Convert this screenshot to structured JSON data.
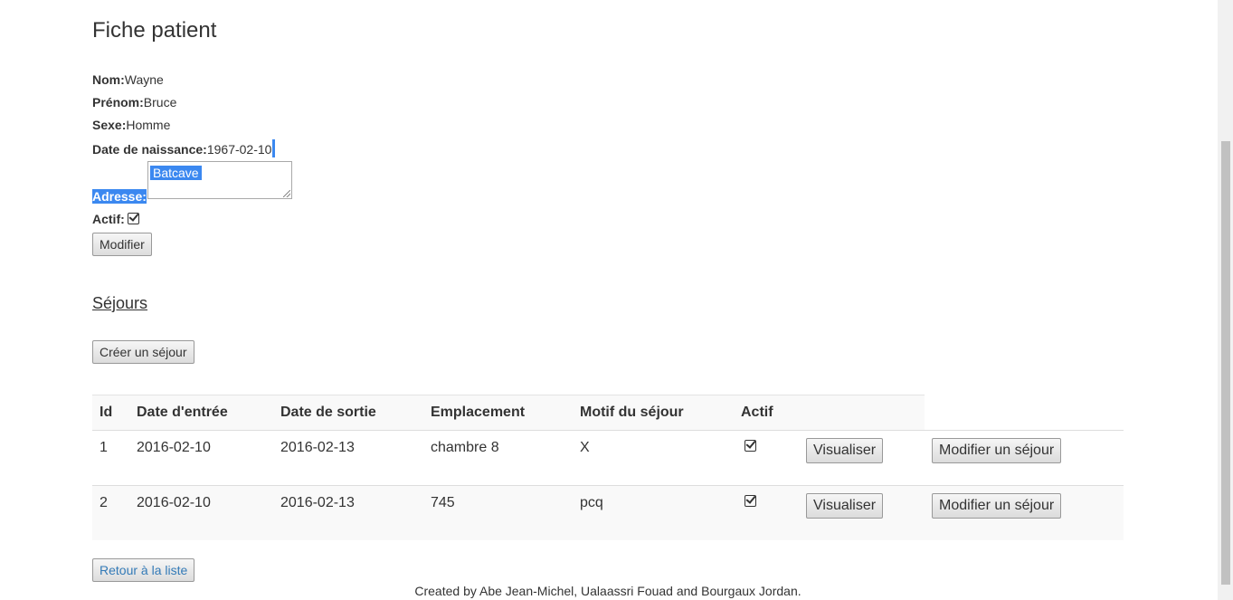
{
  "patient": {
    "title": "Fiche patient",
    "nom_label": "Nom:",
    "nom": "Wayne",
    "prenom_label": "Prénom:",
    "prenom": "Bruce",
    "sexe_label": "Sexe:",
    "sexe": "Homme",
    "naissance_label": "Date de naissance:",
    "naissance": "1967-02-10",
    "adresse_label": "Adresse:",
    "adresse": "Batcave",
    "actif_label": "Actif:",
    "modifier_label": "Modifier"
  },
  "sejours": {
    "title": "Séjours",
    "creer_label": "Créer un séjour",
    "headers": [
      "Id",
      "Date d'entrée",
      "Date de sortie",
      "Emplacement",
      "Motif du séjour",
      "Actif"
    ],
    "rows": [
      {
        "id": "1",
        "entree": "2016-02-10",
        "sortie": "2016-02-13",
        "emplacement": "chambre 8",
        "motif": "X",
        "actif": true
      },
      {
        "id": "2",
        "entree": "2016-02-10",
        "sortie": "2016-02-13",
        "emplacement": "745",
        "motif": "pcq",
        "actif": true
      }
    ],
    "visualiser_label": "Visualiser",
    "modifier_sejour_label": "Modifier un séjour"
  },
  "retour_label": "Retour à la liste",
  "footer": "Created by Abe Jean-Michel, Ualaassri Fouad and Bourgaux Jordan.",
  "colors": {
    "link": "#337ab7",
    "selection": "#3b88f0"
  }
}
